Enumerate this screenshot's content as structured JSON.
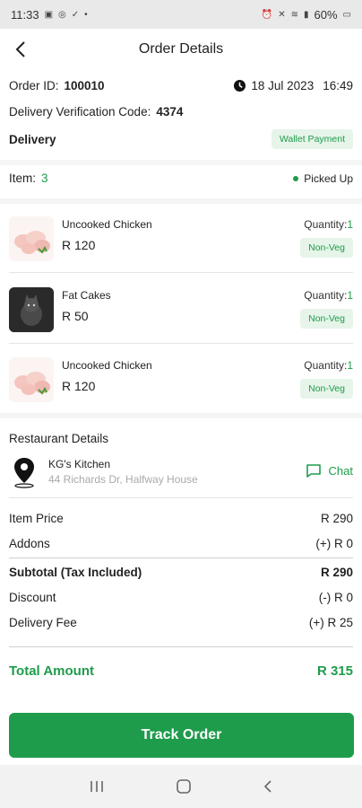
{
  "status": {
    "time": "11:33",
    "battery": "60%"
  },
  "header": {
    "title": "Order Details"
  },
  "order": {
    "id_label": "Order ID:",
    "id": "100010",
    "date": "18 Jul 2023",
    "time": "16:49",
    "verification_label": "Delivery Verification Code:",
    "verification_code": "4374",
    "type": "Delivery",
    "payment_badge": "Wallet Payment",
    "items_label": "Item:",
    "items_count": "3",
    "status": "Picked Up"
  },
  "items": [
    {
      "name": "Uncooked Chicken",
      "price": "R 120",
      "qty_label": "Quantity:",
      "qty": "1",
      "tag": "Non-Veg",
      "image": "raw-chicken"
    },
    {
      "name": "Fat Cakes",
      "price": "R 50",
      "qty_label": "Quantity:",
      "qty": "1",
      "tag": "Non-Veg",
      "image": "dark-cat-photo"
    },
    {
      "name": "Uncooked Chicken",
      "price": "R 120",
      "qty_label": "Quantity:",
      "qty": "1",
      "tag": "Non-Veg",
      "image": "raw-chicken"
    }
  ],
  "restaurant": {
    "section_title": "Restaurant Details",
    "name": "KG's Kitchen",
    "address": "44 Richards Dr, Halfway House",
    "chat_label": "Chat"
  },
  "summary": {
    "item_price_label": "Item Price",
    "item_price": "R 290",
    "addons_label": "Addons",
    "addons": "(+) R 0",
    "subtotal_label": "Subtotal (Tax Included)",
    "subtotal": "R 290",
    "discount_label": "Discount",
    "discount": "(-) R 0",
    "delivery_fee_label": "Delivery Fee",
    "delivery_fee": "(+) R 25",
    "total_label": "Total Amount",
    "total": "R 315"
  },
  "actions": {
    "track_label": "Track Order"
  },
  "colors": {
    "accent": "#1e9c4b",
    "badge_bg": "#e6f4ea"
  }
}
